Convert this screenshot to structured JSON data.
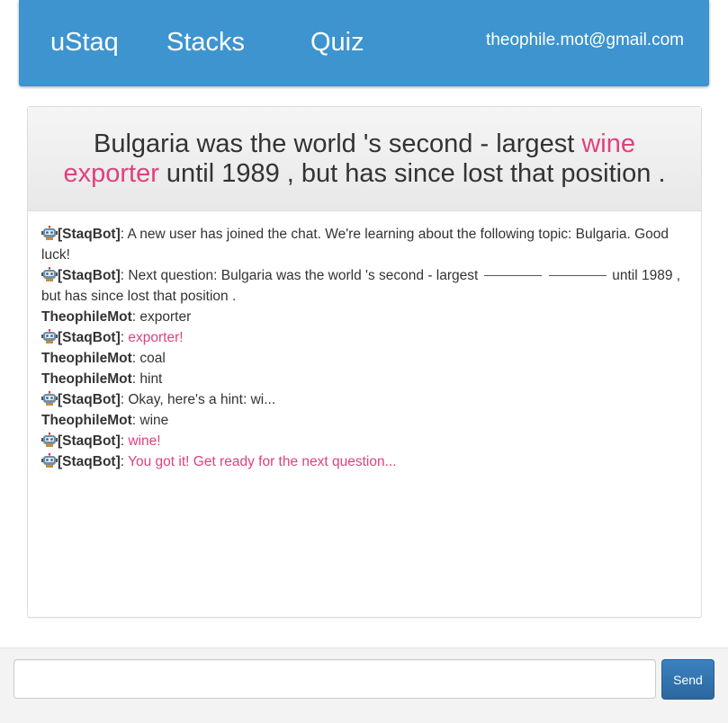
{
  "nav": {
    "brand": "uStaq",
    "stacks": "Stacks",
    "quiz": "Quiz",
    "user_email": "theophile.mot@gmail.com"
  },
  "question": {
    "before": "Bulgaria was the world 's second - largest ",
    "answer": "wine exporter",
    "after": " until 1989 , but has since lost that position ."
  },
  "chat": {
    "bot_name": "[StaqBot]",
    "user_name": "TheophileMot",
    "separator": ": ",
    "bot_icon": "robot-icon",
    "messages": [
      {
        "text": "A new user has joined the chat. We're learning about the following topic: Bulgaria. Good luck!"
      },
      {
        "before": "Next question: Bulgaria was the world 's second - largest ",
        "after": " until 1989 , but has since lost that position ."
      },
      {
        "text": "exporter"
      },
      {
        "text": "exporter!"
      },
      {
        "text": "coal"
      },
      {
        "text": "hint"
      },
      {
        "text": "Okay, here's a hint: wi..."
      },
      {
        "text": "wine"
      },
      {
        "text": "wine!"
      },
      {
        "text": "You got it! Get ready for the next question..."
      }
    ]
  },
  "footer": {
    "input_value": "",
    "input_placeholder": "",
    "send_label": "Send"
  },
  "colors": {
    "navbar": "#3d94cf",
    "highlight": "#e0407f",
    "send_button": "#2f6ea8"
  }
}
